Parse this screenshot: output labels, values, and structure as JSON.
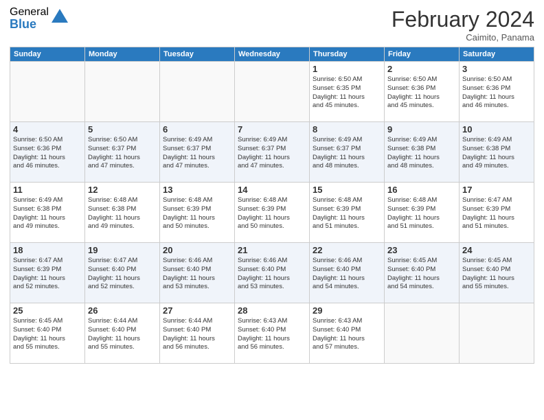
{
  "logo": {
    "general": "General",
    "blue": "Blue"
  },
  "header": {
    "title": "February 2024",
    "subtitle": "Caimito, Panama"
  },
  "weekdays": [
    "Sunday",
    "Monday",
    "Tuesday",
    "Wednesday",
    "Thursday",
    "Friday",
    "Saturday"
  ],
  "weeks": [
    [
      {
        "day": "",
        "info": ""
      },
      {
        "day": "",
        "info": ""
      },
      {
        "day": "",
        "info": ""
      },
      {
        "day": "",
        "info": ""
      },
      {
        "day": "1",
        "info": "Sunrise: 6:50 AM\nSunset: 6:35 PM\nDaylight: 11 hours\nand 45 minutes."
      },
      {
        "day": "2",
        "info": "Sunrise: 6:50 AM\nSunset: 6:36 PM\nDaylight: 11 hours\nand 45 minutes."
      },
      {
        "day": "3",
        "info": "Sunrise: 6:50 AM\nSunset: 6:36 PM\nDaylight: 11 hours\nand 46 minutes."
      }
    ],
    [
      {
        "day": "4",
        "info": "Sunrise: 6:50 AM\nSunset: 6:36 PM\nDaylight: 11 hours\nand 46 minutes."
      },
      {
        "day": "5",
        "info": "Sunrise: 6:50 AM\nSunset: 6:37 PM\nDaylight: 11 hours\nand 47 minutes."
      },
      {
        "day": "6",
        "info": "Sunrise: 6:49 AM\nSunset: 6:37 PM\nDaylight: 11 hours\nand 47 minutes."
      },
      {
        "day": "7",
        "info": "Sunrise: 6:49 AM\nSunset: 6:37 PM\nDaylight: 11 hours\nand 47 minutes."
      },
      {
        "day": "8",
        "info": "Sunrise: 6:49 AM\nSunset: 6:37 PM\nDaylight: 11 hours\nand 48 minutes."
      },
      {
        "day": "9",
        "info": "Sunrise: 6:49 AM\nSunset: 6:38 PM\nDaylight: 11 hours\nand 48 minutes."
      },
      {
        "day": "10",
        "info": "Sunrise: 6:49 AM\nSunset: 6:38 PM\nDaylight: 11 hours\nand 49 minutes."
      }
    ],
    [
      {
        "day": "11",
        "info": "Sunrise: 6:49 AM\nSunset: 6:38 PM\nDaylight: 11 hours\nand 49 minutes."
      },
      {
        "day": "12",
        "info": "Sunrise: 6:48 AM\nSunset: 6:38 PM\nDaylight: 11 hours\nand 49 minutes."
      },
      {
        "day": "13",
        "info": "Sunrise: 6:48 AM\nSunset: 6:39 PM\nDaylight: 11 hours\nand 50 minutes."
      },
      {
        "day": "14",
        "info": "Sunrise: 6:48 AM\nSunset: 6:39 PM\nDaylight: 11 hours\nand 50 minutes."
      },
      {
        "day": "15",
        "info": "Sunrise: 6:48 AM\nSunset: 6:39 PM\nDaylight: 11 hours\nand 51 minutes."
      },
      {
        "day": "16",
        "info": "Sunrise: 6:48 AM\nSunset: 6:39 PM\nDaylight: 11 hours\nand 51 minutes."
      },
      {
        "day": "17",
        "info": "Sunrise: 6:47 AM\nSunset: 6:39 PM\nDaylight: 11 hours\nand 51 minutes."
      }
    ],
    [
      {
        "day": "18",
        "info": "Sunrise: 6:47 AM\nSunset: 6:39 PM\nDaylight: 11 hours\nand 52 minutes."
      },
      {
        "day": "19",
        "info": "Sunrise: 6:47 AM\nSunset: 6:40 PM\nDaylight: 11 hours\nand 52 minutes."
      },
      {
        "day": "20",
        "info": "Sunrise: 6:46 AM\nSunset: 6:40 PM\nDaylight: 11 hours\nand 53 minutes."
      },
      {
        "day": "21",
        "info": "Sunrise: 6:46 AM\nSunset: 6:40 PM\nDaylight: 11 hours\nand 53 minutes."
      },
      {
        "day": "22",
        "info": "Sunrise: 6:46 AM\nSunset: 6:40 PM\nDaylight: 11 hours\nand 54 minutes."
      },
      {
        "day": "23",
        "info": "Sunrise: 6:45 AM\nSunset: 6:40 PM\nDaylight: 11 hours\nand 54 minutes."
      },
      {
        "day": "24",
        "info": "Sunrise: 6:45 AM\nSunset: 6:40 PM\nDaylight: 11 hours\nand 55 minutes."
      }
    ],
    [
      {
        "day": "25",
        "info": "Sunrise: 6:45 AM\nSunset: 6:40 PM\nDaylight: 11 hours\nand 55 minutes."
      },
      {
        "day": "26",
        "info": "Sunrise: 6:44 AM\nSunset: 6:40 PM\nDaylight: 11 hours\nand 55 minutes."
      },
      {
        "day": "27",
        "info": "Sunrise: 6:44 AM\nSunset: 6:40 PM\nDaylight: 11 hours\nand 56 minutes."
      },
      {
        "day": "28",
        "info": "Sunrise: 6:43 AM\nSunset: 6:40 PM\nDaylight: 11 hours\nand 56 minutes."
      },
      {
        "day": "29",
        "info": "Sunrise: 6:43 AM\nSunset: 6:40 PM\nDaylight: 11 hours\nand 57 minutes."
      },
      {
        "day": "",
        "info": ""
      },
      {
        "day": "",
        "info": ""
      }
    ]
  ]
}
